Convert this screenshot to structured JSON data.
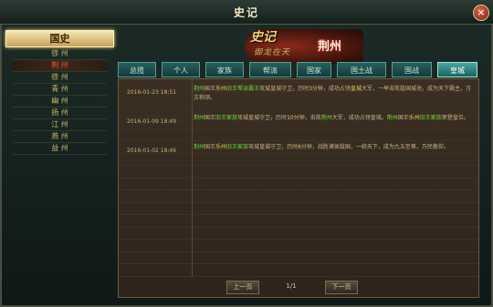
{
  "window": {
    "title": "史记",
    "close_label": "×"
  },
  "sidebar": {
    "header": "国史",
    "items": [
      {
        "label": "徐 州",
        "active": false
      },
      {
        "label": "荆 州",
        "active": true
      },
      {
        "label": "徐 州",
        "active": false
      },
      {
        "label": "青 州",
        "active": false
      },
      {
        "label": "幽 州",
        "active": false
      },
      {
        "label": "扬 州",
        "active": false
      },
      {
        "label": "江 州",
        "active": false
      },
      {
        "label": "燕 州",
        "active": false
      },
      {
        "label": "益 州",
        "active": false
      }
    ]
  },
  "banner": {
    "logo_line1": "史记",
    "logo_line2": "御龙在天",
    "region": "荆州"
  },
  "tabs": [
    {
      "label": "总揽",
      "active": false
    },
    {
      "label": "个人",
      "active": false
    },
    {
      "label": "家族",
      "active": false
    },
    {
      "label": "帮派",
      "active": false
    },
    {
      "label": "国家",
      "active": false
    },
    {
      "label": "国土战",
      "active": false
    },
    {
      "label": "国战",
      "active": false
    },
    {
      "label": "皇城",
      "active": true
    }
  ],
  "entries": [
    {
      "time": "2016-01-23 18:51",
      "parts": [
        {
          "t": "荆州",
          "c": "g"
        },
        {
          "t": "国王"
        },
        {
          "t": "乐州",
          "c": "y"
        },
        {
          "t": "旧王",
          "c": "g"
        },
        {
          "t": "帮派霸王",
          "c": "g"
        },
        {
          "t": "攻城皇城守卫，历时"
        },
        {
          "t": "3",
          "c": "y"
        },
        {
          "t": "分钟，成功占领"
        },
        {
          "t": "皇城",
          "c": "y"
        },
        {
          "t": "大军，一举击败敌国城池，成为天下霸主，万古称颂。"
        }
      ]
    },
    {
      "time": "2016-01-09 18:49",
      "parts": [
        {
          "t": "荆州",
          "c": "g"
        },
        {
          "t": "国王"
        },
        {
          "t": "旧王家族",
          "c": "g"
        },
        {
          "t": "攻城皇城守卫，历时"
        },
        {
          "t": "10",
          "c": "y"
        },
        {
          "t": "分钟，击败"
        },
        {
          "t": "荆州",
          "c": "g"
        },
        {
          "t": "大军，成功占领皇城。"
        },
        {
          "t": "荆州",
          "c": "g"
        },
        {
          "t": "国王"
        },
        {
          "t": "乐州",
          "c": "y"
        },
        {
          "t": "旧王家族",
          "c": "g"
        },
        {
          "t": "荣登皇位。"
        }
      ]
    },
    {
      "time": "2016-01-02 18:46",
      "parts": [
        {
          "t": "荆州",
          "c": "g"
        },
        {
          "t": "国王"
        },
        {
          "t": "乐州",
          "c": "y"
        },
        {
          "t": "旧王家族",
          "c": "g"
        },
        {
          "t": "攻城皇城守卫，历时"
        },
        {
          "t": "6",
          "c": "y"
        },
        {
          "t": "分钟，战胜诸侯敌国，一统天下，成为九五至尊，万民敬仰。"
        }
      ]
    }
  ],
  "pager": {
    "prev": "上一页",
    "page": "1/1",
    "next": "下一页"
  }
}
